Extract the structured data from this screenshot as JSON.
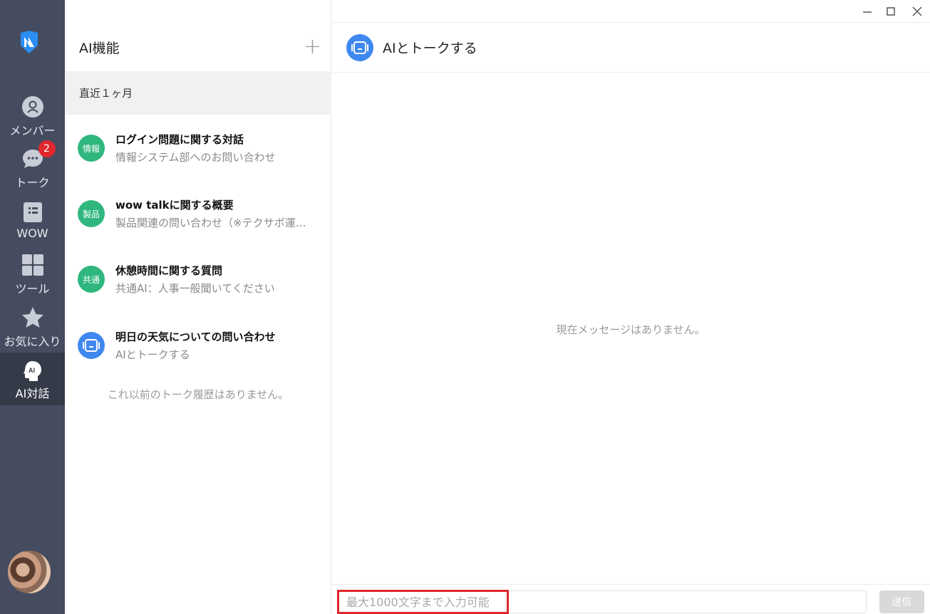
{
  "nav": {
    "items": [
      {
        "label": "メンバー",
        "icon": "person-icon"
      },
      {
        "label": "トーク",
        "icon": "chat-bubble-icon",
        "badge": "2"
      },
      {
        "label": "WOW",
        "icon": "document-list-icon"
      },
      {
        "label": "ツール",
        "icon": "grid-icon"
      },
      {
        "label": "お気に入り",
        "icon": "star-icon"
      },
      {
        "label": "AI対話",
        "icon": "ai-head-icon",
        "active": true
      }
    ],
    "collapse_glyph": "›"
  },
  "list": {
    "title": "AI機能",
    "add_glyph": "+",
    "section": "直近１ヶ月",
    "conversations": [
      {
        "badge": "情報",
        "title": "ログイン問題に関する対話",
        "subtitle": "情報システム部へのお問い合わせ",
        "color": "#2fb77e"
      },
      {
        "badge": "製品",
        "title": "wow talkに関する概要",
        "subtitle": "製品関連の問い合わせ（※テクサポ運…",
        "color": "#2fb77e"
      },
      {
        "badge": "共通",
        "title": "休憩時間に関する質問",
        "subtitle": "共通AI：人事一般聞いてください",
        "color": "#2fb77e"
      },
      {
        "badge": "",
        "title": "明日の天気についての問い合わせ",
        "subtitle": "AIとトークする",
        "color": "#3f88f0"
      }
    ],
    "no_more": "これ以前のトーク履歴はありません。"
  },
  "chat": {
    "title": "AIとトークする",
    "empty": "現在メッセージはありません。",
    "input_placeholder": "最大1000文字まで入力可能",
    "send_label": "送信"
  },
  "colors": {
    "nav_bg": "#464c5f",
    "accent_green": "#2fb77e",
    "accent_blue": "#3f88f0",
    "badge_red": "#e0282e",
    "highlight_red": "#e1262e"
  }
}
